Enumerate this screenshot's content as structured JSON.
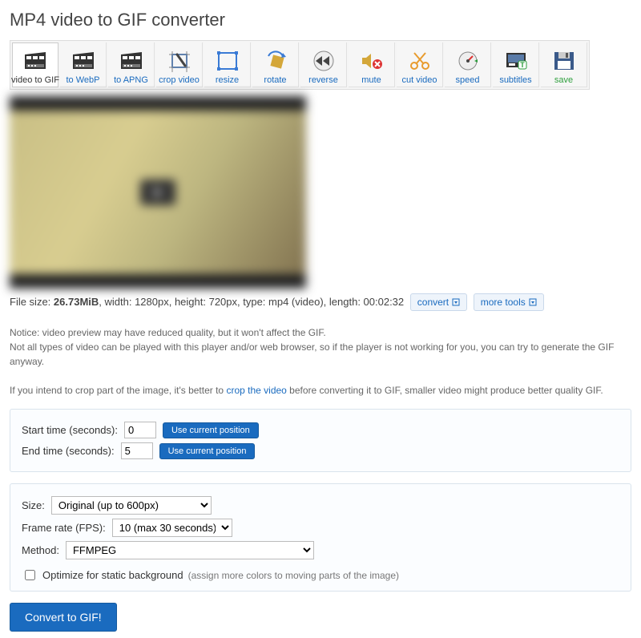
{
  "title": "MP4 video to GIF converter",
  "tools": [
    {
      "id": "video-to-gif",
      "label": "video to GIF",
      "active": true,
      "icon": "film"
    },
    {
      "id": "to-webp",
      "label": "to WebP",
      "icon": "film"
    },
    {
      "id": "to-apng",
      "label": "to APNG",
      "icon": "film"
    },
    {
      "id": "crop-video",
      "label": "crop video",
      "icon": "crop"
    },
    {
      "id": "resize",
      "label": "resize",
      "icon": "resize"
    },
    {
      "id": "rotate",
      "label": "rotate",
      "icon": "rotate"
    },
    {
      "id": "reverse",
      "label": "reverse",
      "icon": "reverse"
    },
    {
      "id": "mute",
      "label": "mute",
      "icon": "mute"
    },
    {
      "id": "cut-video",
      "label": "cut video",
      "icon": "cut"
    },
    {
      "id": "speed",
      "label": "speed",
      "icon": "speed"
    },
    {
      "id": "subtitles",
      "label": "subtitles",
      "icon": "subtitles"
    },
    {
      "id": "save",
      "label": "save",
      "icon": "save",
      "save": true
    }
  ],
  "meta": {
    "file_size_label": "File size: ",
    "file_size": "26.73MiB",
    "rest": ", width: 1280px, height: 720px, type: mp4 (video), length: 00:02:32"
  },
  "buttons": {
    "convert": "convert",
    "more_tools": "more tools"
  },
  "notice_line1": "Notice: video preview may have reduced quality, but it won't affect the GIF.",
  "notice_line2": "Not all types of video can be played with this player and/or web browser, so if the player is not working for you, you can try to generate the GIF anyway.",
  "notice_line3_pre": "If you intend to crop part of the image, it's better to ",
  "notice_line3_link": "crop the video",
  "notice_line3_post": " before converting it to GIF, smaller video might produce better quality GIF.",
  "time_panel": {
    "start_label": "Start time (seconds):",
    "start_value": "0",
    "end_label": "End time (seconds):",
    "end_value": "5",
    "use_current": "Use current position"
  },
  "opts_panel": {
    "size_label": "Size:",
    "size_value": "Original (up to 600px)",
    "fps_label": "Frame rate (FPS):",
    "fps_value": "10 (max 30 seconds)",
    "method_label": "Method:",
    "method_value": "FFMPEG",
    "optimize_label": "Optimize for static background",
    "optimize_hint": "(assign more colors to moving parts of the image)"
  },
  "convert_btn": "Convert to GIF!"
}
